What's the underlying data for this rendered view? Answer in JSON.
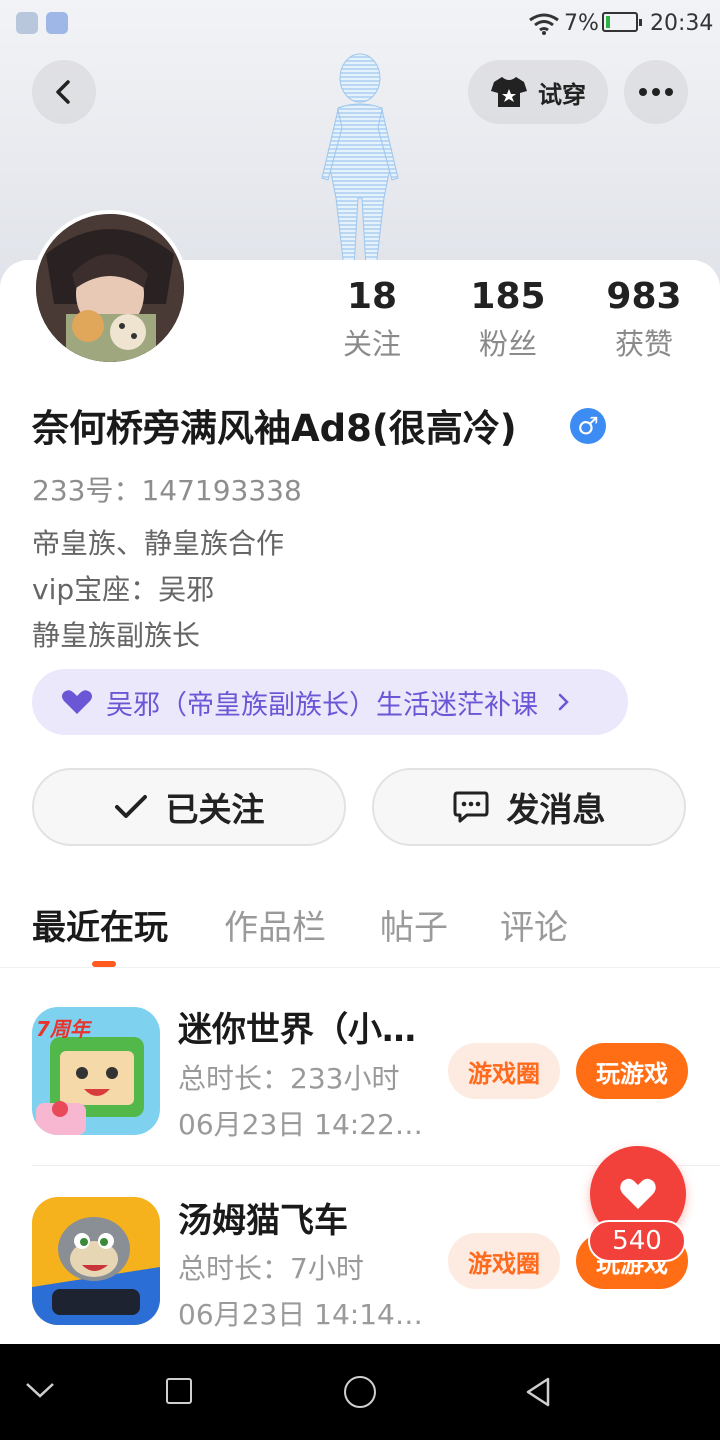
{
  "status_bar": {
    "battery": "7%",
    "time": "20:34"
  },
  "header": {
    "try_on_label": "试穿"
  },
  "profile": {
    "stats": [
      {
        "value": "18",
        "label": "关注"
      },
      {
        "value": "185",
        "label": "粉丝"
      },
      {
        "value": "983",
        "label": "获赞"
      }
    ],
    "name": "奈何桥旁满风袖Ad8(很高冷)",
    "gender_symbol": "♂",
    "uid": "233号：147193338",
    "bio": [
      "帝皇族、静皇族合作",
      "vip宝座：吴邪",
      "静皇族副族长"
    ],
    "banner_text": "吴邪（帝皇族副族长）生活迷茫补课",
    "follow_label": "已关注",
    "message_label": "发消息"
  },
  "tabs": [
    "最近在玩",
    "作品栏",
    "帖子",
    "评论"
  ],
  "active_tab": "最近在玩",
  "games": [
    {
      "title": "迷你世界（小…",
      "duration": "总时长：233小时",
      "last_played": "06月23日 14:22…",
      "icon_badge": "7周年",
      "circle_label": "游戏圈",
      "play_label": "玩游戏"
    },
    {
      "title": "汤姆猫飞车",
      "duration": "总时长：7小时",
      "last_played": "06月23日 14:14…",
      "circle_label": "游戏圈",
      "play_label": "玩游戏"
    }
  ],
  "like_fab": {
    "count": "540"
  },
  "colors": {
    "accent": "#ff6d14",
    "like": "#f2403a",
    "banner_text": "#6b56d6",
    "gender": "#3d8cf3"
  }
}
